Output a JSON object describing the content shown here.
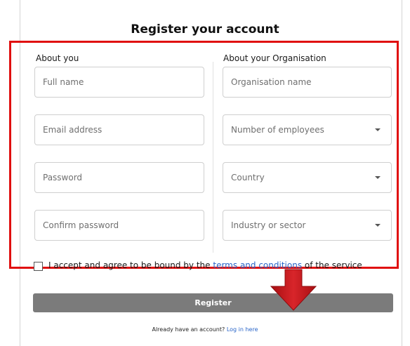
{
  "form": {
    "title": "Register your account",
    "about_you": {
      "heading": "About you",
      "fields": [
        {
          "placeholder": "Full name"
        },
        {
          "placeholder": "Email address"
        },
        {
          "placeholder": "Password"
        },
        {
          "placeholder": "Confirm password"
        }
      ]
    },
    "about_org": {
      "heading": "About your Organisation",
      "fields": [
        {
          "placeholder": "Organisation name",
          "dropdown": false
        },
        {
          "placeholder": "Number of employees",
          "dropdown": true
        },
        {
          "placeholder": "Country",
          "dropdown": true
        },
        {
          "placeholder": "Industry or sector",
          "dropdown": true
        }
      ]
    },
    "terms": {
      "prefix": "I accept and agree to be bound by the",
      "link": "terms and conditions",
      "suffix": "of the service",
      "checked": false
    },
    "register_label": "Register",
    "login": {
      "prompt": "Already have an account?",
      "link": "Log in here"
    }
  },
  "colors": {
    "highlight": "#e01010",
    "arrow": "#c8181c",
    "button": "#7b7b7b",
    "link": "#2a66c9"
  },
  "icons": {
    "dropdown": "chevron-down-icon",
    "annotation": "red-down-arrow"
  }
}
